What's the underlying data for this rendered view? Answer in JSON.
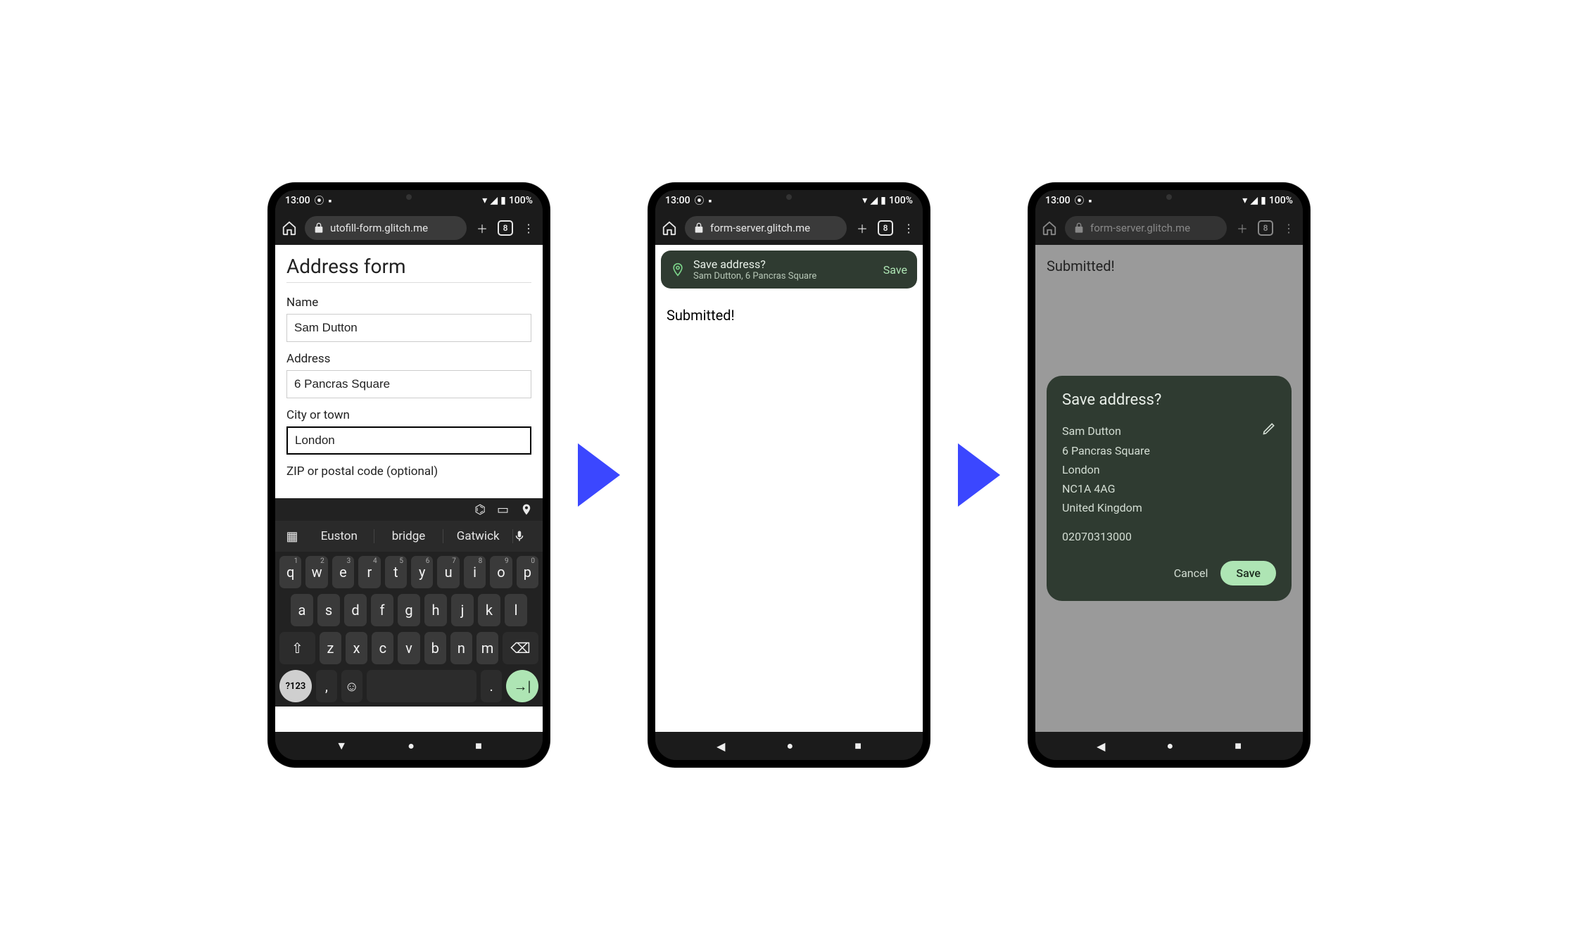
{
  "status": {
    "time": "13:00",
    "battery": "100%"
  },
  "browser": {
    "url1": "utofill-form.glitch.me",
    "url2": "form-server.glitch.me",
    "url3": "form-server.glitch.me",
    "tab_count": "8"
  },
  "form": {
    "title": "Address form",
    "name_label": "Name",
    "name_value": "Sam Dutton",
    "address_label": "Address",
    "address_value": "6 Pancras Square",
    "city_label": "City or town",
    "city_value": "London",
    "zip_label": "ZIP or postal code (optional)"
  },
  "keyboard": {
    "sugg1": "Euston",
    "sugg2": "bridge",
    "sugg3": "Gatwick",
    "row1": [
      {
        "k": "q",
        "s": "1"
      },
      {
        "k": "w",
        "s": "2"
      },
      {
        "k": "e",
        "s": "3"
      },
      {
        "k": "r",
        "s": "4"
      },
      {
        "k": "t",
        "s": "5"
      },
      {
        "k": "y",
        "s": "6"
      },
      {
        "k": "u",
        "s": "7"
      },
      {
        "k": "i",
        "s": "8"
      },
      {
        "k": "o",
        "s": "9"
      },
      {
        "k": "p",
        "s": "0"
      }
    ],
    "row2": [
      "a",
      "s",
      "d",
      "f",
      "g",
      "h",
      "j",
      "k",
      "l"
    ],
    "row3": [
      "z",
      "x",
      "c",
      "v",
      "b",
      "n",
      "m"
    ],
    "sym_label": "?123"
  },
  "page2": {
    "submitted": "Submitted!",
    "banner_title": "Save address?",
    "banner_sub": "Sam Dutton, 6 Pancras Square",
    "banner_save": "Save"
  },
  "page3": {
    "submitted": "Submitted!",
    "dialog_title": "Save address?",
    "lines": {
      "l1": "Sam Dutton",
      "l2": "6 Pancras Square",
      "l3": "London",
      "l4": "NC1A 4AG",
      "l5": "United Kingdom"
    },
    "phone": "02070313000",
    "cancel": "Cancel",
    "save": "Save"
  }
}
